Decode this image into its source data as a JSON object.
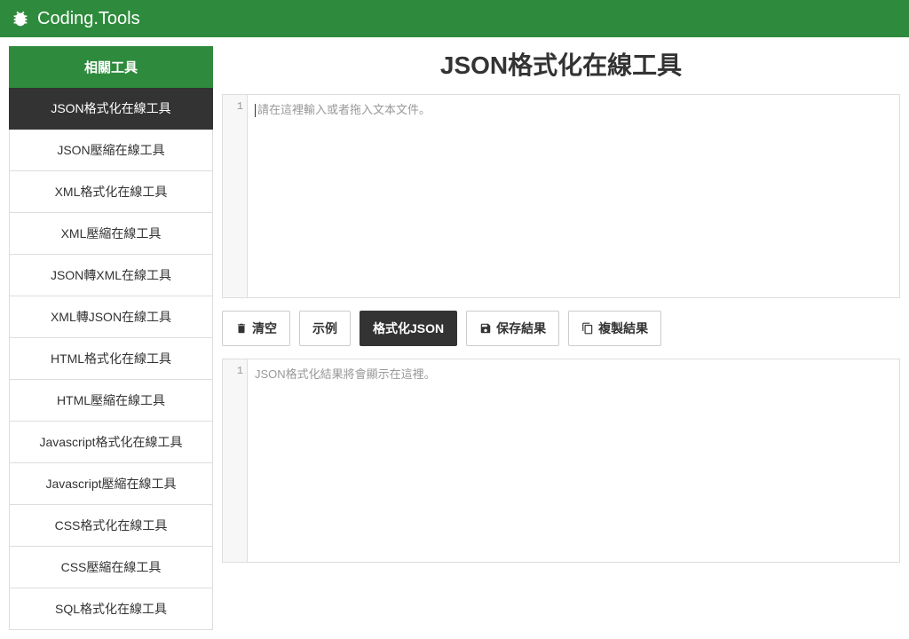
{
  "header": {
    "brand": "Coding.Tools"
  },
  "sidebar": {
    "title": "相關工具",
    "items": [
      {
        "label": "JSON格式化在線工具",
        "active": true
      },
      {
        "label": "JSON壓縮在線工具",
        "active": false
      },
      {
        "label": "XML格式化在線工具",
        "active": false
      },
      {
        "label": "XML壓縮在線工具",
        "active": false
      },
      {
        "label": "JSON轉XML在線工具",
        "active": false
      },
      {
        "label": "XML轉JSON在線工具",
        "active": false
      },
      {
        "label": "HTML格式化在線工具",
        "active": false
      },
      {
        "label": "HTML壓縮在線工具",
        "active": false
      },
      {
        "label": "Javascript格式化在線工具",
        "active": false
      },
      {
        "label": "Javascript壓縮在線工具",
        "active": false
      },
      {
        "label": "CSS格式化在線工具",
        "active": false
      },
      {
        "label": "CSS壓縮在線工具",
        "active": false
      },
      {
        "label": "SQL格式化在線工具",
        "active": false
      }
    ]
  },
  "main": {
    "title": "JSON格式化在線工具",
    "input": {
      "line_number": "1",
      "placeholder": "請在這裡輸入或者拖入文本文件。"
    },
    "output": {
      "line_number": "1",
      "placeholder": "JSON格式化結果將會顯示在這裡。"
    }
  },
  "toolbar": {
    "clear": "清空",
    "example": "示例",
    "format": "格式化JSON",
    "save": "保存結果",
    "copy": "複製結果"
  }
}
